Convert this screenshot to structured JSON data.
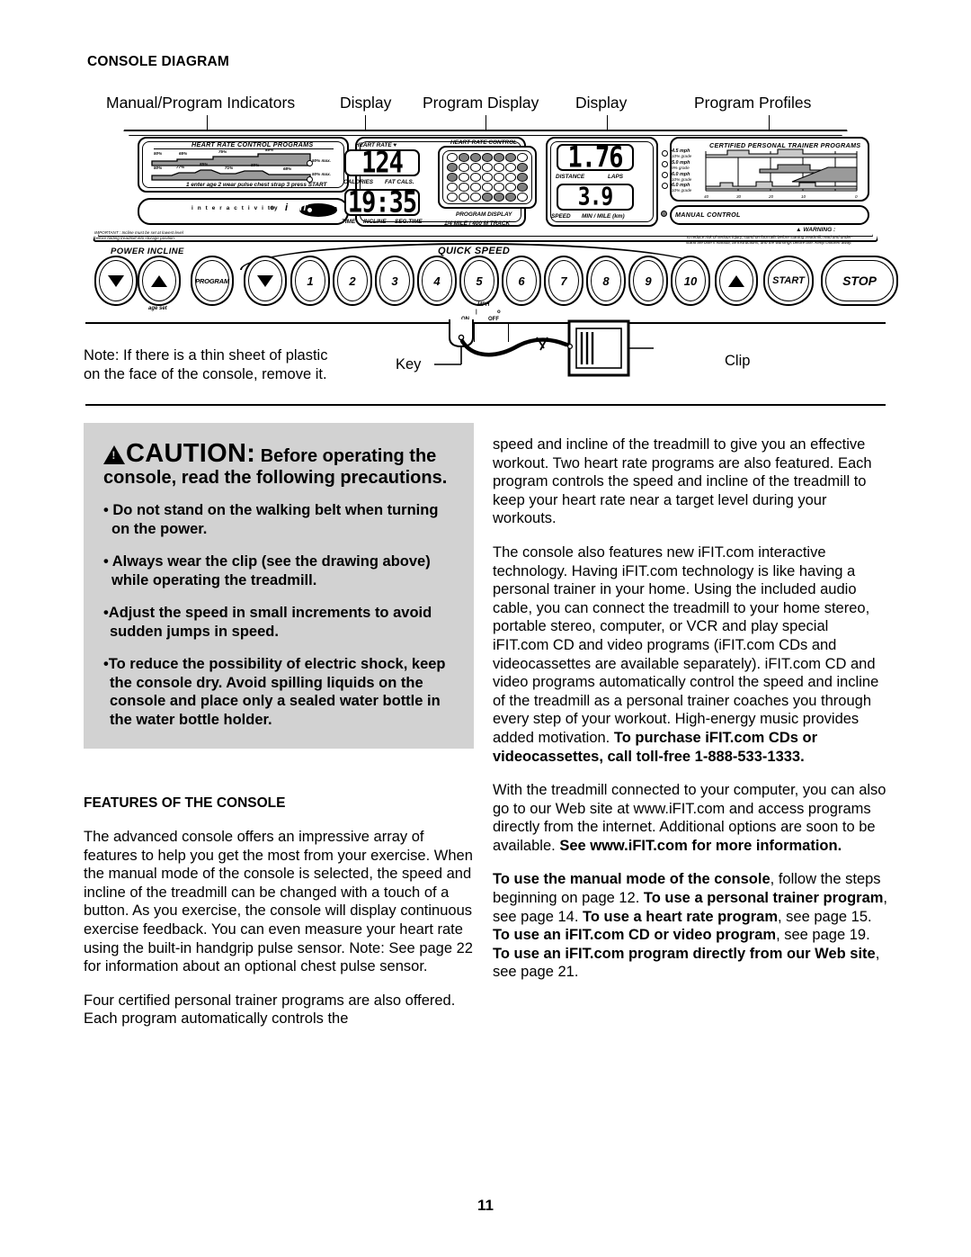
{
  "section": {
    "title": "CONSOLE DIAGRAM"
  },
  "callouts": [
    {
      "label": "Manual/Program Indicators"
    },
    {
      "label": "Display"
    },
    {
      "label": "Program Display"
    },
    {
      "label": "Display"
    },
    {
      "label": "Program Profiles"
    }
  ],
  "console": {
    "heart_rate_panel": {
      "title": "HEART RATE CONTROL PROGRAMS",
      "profile_1_labels": [
        "50%",
        "65%",
        "75%",
        "85%",
        "50% max."
      ],
      "profile_2_labels": [
        "50%",
        "77%",
        "85%",
        "71%",
        "80%",
        "68%",
        "50% max."
      ],
      "instructions": "1  enter age  2  wear pulse chest strap  3  press START"
    },
    "interactivity_bar": {
      "text": "i n t e r a c t i v i t y",
      "symbol": "⊕",
      "logo": "iFIT.com"
    },
    "important_note": "IMPORTANT : Incline must be set at lowest level\nbefore folding treadmill into storage position.",
    "display_left": {
      "top_label": "HEART RATE ♥",
      "top_value": "124",
      "top_units": [
        "CALORIES",
        "FAT CALS."
      ],
      "bottom_value": "19:35",
      "bottom_units": [
        "TIME",
        "INCLINE",
        "SEG.TIME"
      ]
    },
    "program_display": {
      "top_label": "HEART RATE CONTROL",
      "caption_1": "PROGRAM DISPLAY",
      "caption_2": "1/4 MILE / 400 M TRACK",
      "matrix": [
        [
          0,
          1,
          1,
          1,
          1,
          1,
          0
        ],
        [
          1,
          0,
          0,
          0,
          0,
          0,
          1
        ],
        [
          1,
          0,
          0,
          0,
          0,
          0,
          1
        ],
        [
          0,
          0,
          0,
          0,
          0,
          0,
          1
        ],
        [
          0,
          0,
          0,
          1,
          1,
          1,
          0
        ]
      ]
    },
    "display_right": {
      "top_value": "1.76",
      "top_units": [
        "DISTANCE",
        "LAPS"
      ],
      "bottom_value": "3.9",
      "bottom_units": [
        "SPEED",
        "MIN / MILE (km)"
      ]
    },
    "trainer_panel": {
      "title": "CERTIFIED PERSONAL TRAINER PROGRAMS",
      "programs": [
        {
          "speed": "4.5 mph",
          "grade": "10% grade"
        },
        {
          "speed": "5.0 mph",
          "grade": "9% grade"
        },
        {
          "speed": "6.0 mph",
          "grade": "10% grade"
        },
        {
          "speed": "6.0 mph",
          "grade": "10% grade"
        }
      ],
      "axis_ticks": [
        "40",
        "30",
        "20",
        "10",
        "0"
      ]
    },
    "manual_control_label": "MANUAL CONTROL",
    "warning": {
      "heading": "▲ WARNING :",
      "text": "To reduce risk of serious injury, stand on foot rails before starting treadmill, read and under-\nstand the user's manual, all instructions, and the warnings before use.  Keep children away."
    },
    "buttons": {
      "power_incline_label": "POWER INCLINE",
      "age_set_label": "age set",
      "incline_down": "▼",
      "incline_up": "▲",
      "program_label": "PROGRAM",
      "quick_speed_label": "QUICK SPEED",
      "mph_label": "MPH",
      "speed_down": "▼",
      "speed_up": "▲",
      "numbers": [
        "1",
        "2",
        "3",
        "4",
        "5",
        "6",
        "7",
        "8",
        "9",
        "10"
      ],
      "start_label": "START",
      "stop_label": "STOP",
      "switch_on": "ON",
      "switch_off": "OFF"
    }
  },
  "key_clip": {
    "note": "Note: If there is a thin sheet of plastic\non the face of the console, remove it.",
    "key_label": "Key",
    "clip_label": "Clip"
  },
  "caution": {
    "triangle_symbol": "!",
    "word": "CAUTION:",
    "lead": " Before operating the console, read the following precautions.",
    "items": [
      "• Do not stand on the walking belt when turning on the power.",
      "• Always wear the clip (see the drawing above) while operating the treadmill.",
      "•Adjust the speed in small increments to avoid sudden jumps in speed.",
      "•To reduce the possibility of electric shock, keep the console dry. Avoid spilling liquids on the console and place only a sealed water bottle in the water bottle holder."
    ]
  },
  "features": {
    "heading": "FEATURES OF THE CONSOLE",
    "paragraph_1": "The advanced console offers an impressive array of features to help you get the most from your exercise. When the manual mode of the console is selected, the speed and incline of the treadmill can be changed with a touch of a button. As you exercise, the console will display continuous exercise feedback. You can even measure your heart rate using the built-in handgrip pulse sensor. Note: See page 22 for information about an optional chest pulse sensor.",
    "paragraph_2": "Four certified personal trainer programs are also offered. Each program automatically controls the"
  },
  "right_column": {
    "paragraph_1": "speed and incline of the treadmill to give you an effective workout. Two heart rate programs are also featured. Each program controls the speed and incline of the treadmill to keep your heart rate near a target level during your workouts.",
    "paragraph_2_plain_a": "The console also features new iFIT.com interactive technology. Having iFIT.com technology is like having a personal trainer in your home. Using the included audio cable, you can connect the treadmill to your home stereo, portable stereo, computer, or VCR and play special iFIT.com CD and video programs (iFIT.com CDs and videocassettes are available separately). iFIT.com CD and video programs automatically control the speed and incline of the treadmill as a personal trainer coaches you through every step of your workout. High-energy music provides added motivation. ",
    "paragraph_2_bold_b": "To purchase iFIT.com CDs or videocassettes, call toll-free 1-888-533-1333.",
    "paragraph_3_plain_a": "With the treadmill connected to your computer, you can also go to our Web site at www.iFIT.com and access programs directly from the internet. Additional options are soon to be available. ",
    "paragraph_3_bold_b": "See www.iFIT.com for more information.",
    "paragraph_4_bold_a": "To use the manual mode of the console",
    "paragraph_4_plain_b": ", follow the steps beginning on page 12. ",
    "paragraph_4_bold_c": "To use a personal trainer program",
    "paragraph_4_plain_d": ", see page 14. ",
    "paragraph_4_bold_e": "To use a heart rate program",
    "paragraph_4_plain_f": ", see page 15. ",
    "paragraph_4_bold_g": "To use an iFIT.com CD or video program",
    "paragraph_4_plain_h": ", see page 19. ",
    "paragraph_4_bold_i": "To use an iFIT.com program directly from our Web site",
    "paragraph_4_plain_j": ", see page 21."
  },
  "footer": {
    "page_number": "11"
  }
}
